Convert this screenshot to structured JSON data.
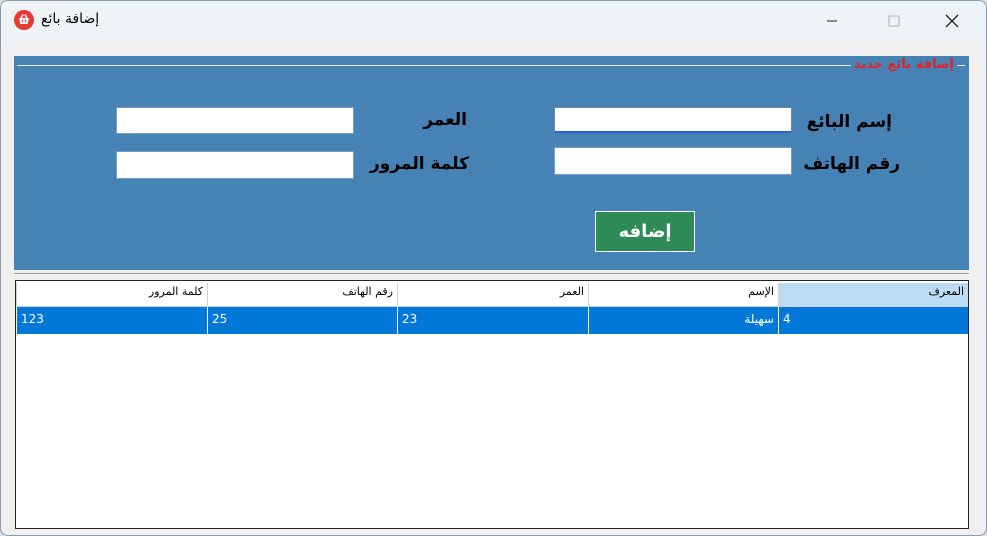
{
  "window": {
    "title": "إضافة بائع",
    "icon": "shopping-basket-icon",
    "controls": [
      "minimize-icon",
      "maximize-icon",
      "close-icon"
    ]
  },
  "form": {
    "group_title": "إضافة بائع جديد",
    "seller_name_label": "إسم البائع",
    "seller_name_value": "",
    "phone_label": "رقم الهاتف",
    "phone_value": "",
    "age_label": "العمر",
    "age_value": "",
    "password_label": "كلمة المرور",
    "password_value": "",
    "add_button": "إضافه"
  },
  "grid": {
    "columns": [
      "المعرف",
      "الإسم",
      "العمر",
      "رقم الهاتف",
      "كلمة المرور"
    ],
    "rows": [
      {
        "id": "4",
        "name": "سهيلة",
        "age": "23",
        "phone": "25",
        "password": "123"
      }
    ],
    "selected_row": 0
  },
  "colors": {
    "panel": "#4682b4",
    "group_title": "#e02424",
    "add_button": "#2e8b57",
    "selection": "#0078d7",
    "header_selected": "#bcdcf4"
  }
}
